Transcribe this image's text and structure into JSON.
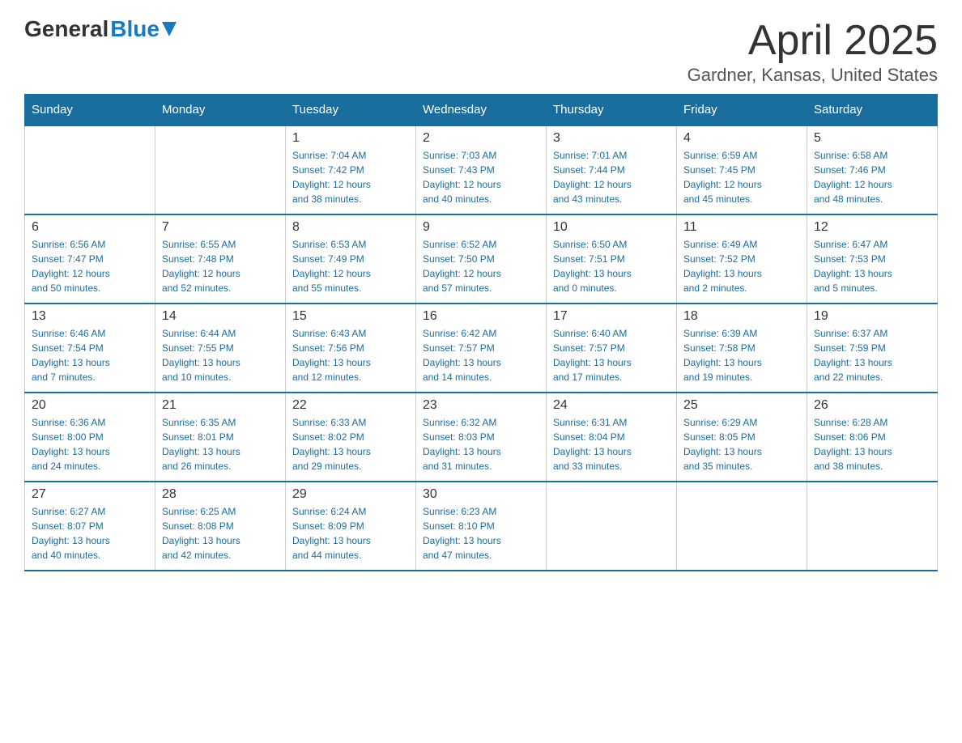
{
  "header": {
    "logo_general": "General",
    "logo_blue": "Blue",
    "month_title": "April 2025",
    "location": "Gardner, Kansas, United States"
  },
  "days_of_week": [
    "Sunday",
    "Monday",
    "Tuesday",
    "Wednesday",
    "Thursday",
    "Friday",
    "Saturday"
  ],
  "weeks": [
    [
      {
        "day": "",
        "info": ""
      },
      {
        "day": "",
        "info": ""
      },
      {
        "day": "1",
        "info": "Sunrise: 7:04 AM\nSunset: 7:42 PM\nDaylight: 12 hours\nand 38 minutes."
      },
      {
        "day": "2",
        "info": "Sunrise: 7:03 AM\nSunset: 7:43 PM\nDaylight: 12 hours\nand 40 minutes."
      },
      {
        "day": "3",
        "info": "Sunrise: 7:01 AM\nSunset: 7:44 PM\nDaylight: 12 hours\nand 43 minutes."
      },
      {
        "day": "4",
        "info": "Sunrise: 6:59 AM\nSunset: 7:45 PM\nDaylight: 12 hours\nand 45 minutes."
      },
      {
        "day": "5",
        "info": "Sunrise: 6:58 AM\nSunset: 7:46 PM\nDaylight: 12 hours\nand 48 minutes."
      }
    ],
    [
      {
        "day": "6",
        "info": "Sunrise: 6:56 AM\nSunset: 7:47 PM\nDaylight: 12 hours\nand 50 minutes."
      },
      {
        "day": "7",
        "info": "Sunrise: 6:55 AM\nSunset: 7:48 PM\nDaylight: 12 hours\nand 52 minutes."
      },
      {
        "day": "8",
        "info": "Sunrise: 6:53 AM\nSunset: 7:49 PM\nDaylight: 12 hours\nand 55 minutes."
      },
      {
        "day": "9",
        "info": "Sunrise: 6:52 AM\nSunset: 7:50 PM\nDaylight: 12 hours\nand 57 minutes."
      },
      {
        "day": "10",
        "info": "Sunrise: 6:50 AM\nSunset: 7:51 PM\nDaylight: 13 hours\nand 0 minutes."
      },
      {
        "day": "11",
        "info": "Sunrise: 6:49 AM\nSunset: 7:52 PM\nDaylight: 13 hours\nand 2 minutes."
      },
      {
        "day": "12",
        "info": "Sunrise: 6:47 AM\nSunset: 7:53 PM\nDaylight: 13 hours\nand 5 minutes."
      }
    ],
    [
      {
        "day": "13",
        "info": "Sunrise: 6:46 AM\nSunset: 7:54 PM\nDaylight: 13 hours\nand 7 minutes."
      },
      {
        "day": "14",
        "info": "Sunrise: 6:44 AM\nSunset: 7:55 PM\nDaylight: 13 hours\nand 10 minutes."
      },
      {
        "day": "15",
        "info": "Sunrise: 6:43 AM\nSunset: 7:56 PM\nDaylight: 13 hours\nand 12 minutes."
      },
      {
        "day": "16",
        "info": "Sunrise: 6:42 AM\nSunset: 7:57 PM\nDaylight: 13 hours\nand 14 minutes."
      },
      {
        "day": "17",
        "info": "Sunrise: 6:40 AM\nSunset: 7:57 PM\nDaylight: 13 hours\nand 17 minutes."
      },
      {
        "day": "18",
        "info": "Sunrise: 6:39 AM\nSunset: 7:58 PM\nDaylight: 13 hours\nand 19 minutes."
      },
      {
        "day": "19",
        "info": "Sunrise: 6:37 AM\nSunset: 7:59 PM\nDaylight: 13 hours\nand 22 minutes."
      }
    ],
    [
      {
        "day": "20",
        "info": "Sunrise: 6:36 AM\nSunset: 8:00 PM\nDaylight: 13 hours\nand 24 minutes."
      },
      {
        "day": "21",
        "info": "Sunrise: 6:35 AM\nSunset: 8:01 PM\nDaylight: 13 hours\nand 26 minutes."
      },
      {
        "day": "22",
        "info": "Sunrise: 6:33 AM\nSunset: 8:02 PM\nDaylight: 13 hours\nand 29 minutes."
      },
      {
        "day": "23",
        "info": "Sunrise: 6:32 AM\nSunset: 8:03 PM\nDaylight: 13 hours\nand 31 minutes."
      },
      {
        "day": "24",
        "info": "Sunrise: 6:31 AM\nSunset: 8:04 PM\nDaylight: 13 hours\nand 33 minutes."
      },
      {
        "day": "25",
        "info": "Sunrise: 6:29 AM\nSunset: 8:05 PM\nDaylight: 13 hours\nand 35 minutes."
      },
      {
        "day": "26",
        "info": "Sunrise: 6:28 AM\nSunset: 8:06 PM\nDaylight: 13 hours\nand 38 minutes."
      }
    ],
    [
      {
        "day": "27",
        "info": "Sunrise: 6:27 AM\nSunset: 8:07 PM\nDaylight: 13 hours\nand 40 minutes."
      },
      {
        "day": "28",
        "info": "Sunrise: 6:25 AM\nSunset: 8:08 PM\nDaylight: 13 hours\nand 42 minutes."
      },
      {
        "day": "29",
        "info": "Sunrise: 6:24 AM\nSunset: 8:09 PM\nDaylight: 13 hours\nand 44 minutes."
      },
      {
        "day": "30",
        "info": "Sunrise: 6:23 AM\nSunset: 8:10 PM\nDaylight: 13 hours\nand 47 minutes."
      },
      {
        "day": "",
        "info": ""
      },
      {
        "day": "",
        "info": ""
      },
      {
        "day": "",
        "info": ""
      }
    ]
  ]
}
